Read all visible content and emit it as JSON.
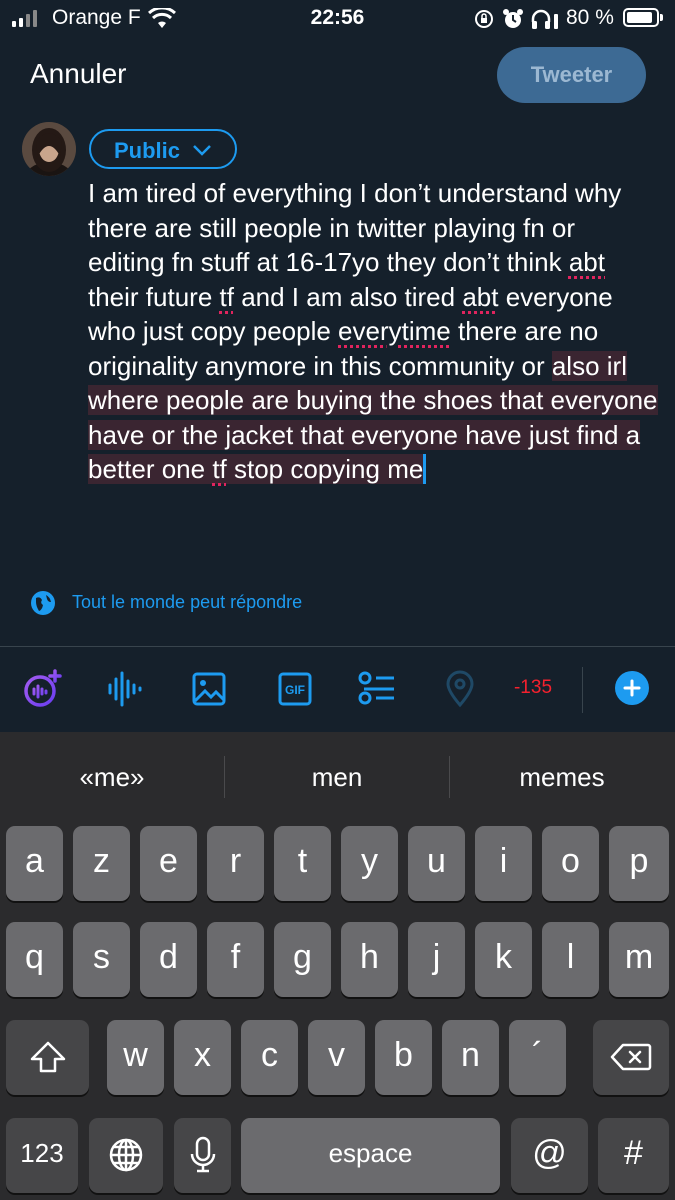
{
  "status_bar": {
    "carrier": "Orange F",
    "time": "22:56",
    "battery_percent": "80 %",
    "signal_bars": 2,
    "battery_level": 0.8
  },
  "header": {
    "cancel_label": "Annuler",
    "tweet_label": "Tweeter"
  },
  "composer": {
    "audience_label": "Public",
    "text_plain": "I am tired of everything I don’t understand why there are still people in twitter playing fn or editing fn stuff at 16-17yo they don’t think ",
    "t_abt1": "abt",
    "t_2": " their future ",
    "t_tf1": "tf",
    "t_3": " and I am also tired ",
    "t_abt2": "abt",
    "t_4": " everyone who just copy people ",
    "t_everytime": "everytime",
    "t_5": " there are no originality anymore in this community or ",
    "t_hl1": "also irl where people are buying the shoes that everyone have or the jacket that everyone have just find a better one ",
    "t_tf2": "tf",
    "t_hl2": " stop copying me",
    "reply_setting": "Tout le monde peut répondre"
  },
  "toolbar": {
    "counter": "-135"
  },
  "keyboard": {
    "suggestions": [
      "«me»",
      "men",
      "memes"
    ],
    "row1": [
      "a",
      "z",
      "e",
      "r",
      "t",
      "y",
      "u",
      "i",
      "o",
      "p"
    ],
    "row2": [
      "q",
      "s",
      "d",
      "f",
      "g",
      "h",
      "j",
      "k",
      "l",
      "m"
    ],
    "row3": [
      "w",
      "x",
      "c",
      "v",
      "b",
      "n",
      "´"
    ],
    "numbers_key": "123",
    "space_key": "espace",
    "at_key": "@",
    "hash_key": "#"
  }
}
